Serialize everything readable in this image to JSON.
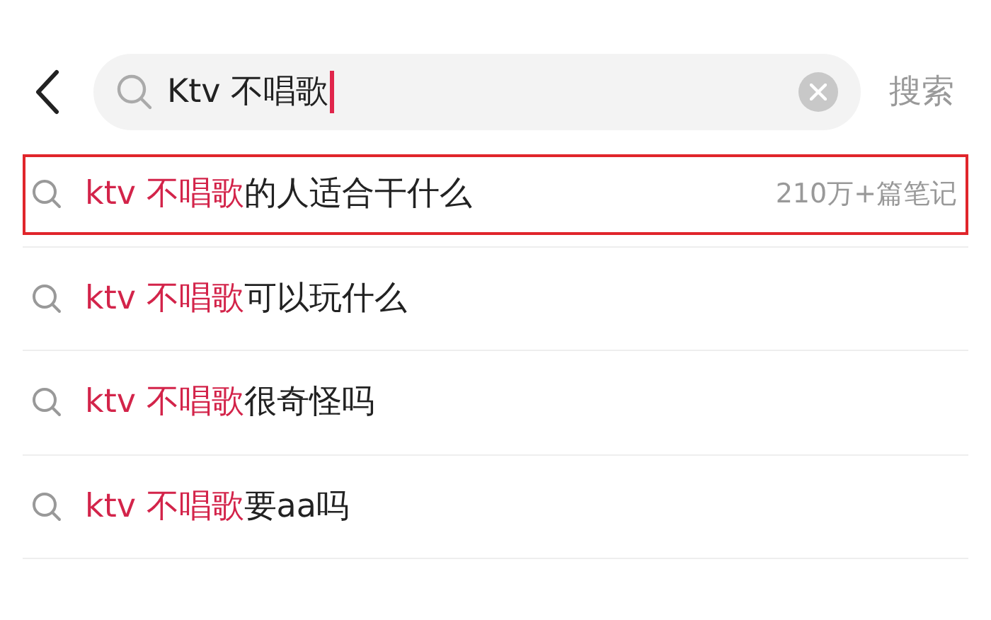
{
  "search": {
    "value": "Ktv 不唱歌",
    "action": "搜索"
  },
  "suggestions": [
    {
      "match": "ktv 不唱歌",
      "rest": "的人适合干什么",
      "count": "210万+篇笔记",
      "selected": true
    },
    {
      "match": "ktv 不唱歌",
      "rest": "可以玩什么",
      "selected": false
    },
    {
      "match": "ktv 不唱歌",
      "rest": "很奇怪吗",
      "selected": false
    },
    {
      "match": "ktv 不唱歌",
      "rest": "要aa吗",
      "selected": false
    }
  ]
}
